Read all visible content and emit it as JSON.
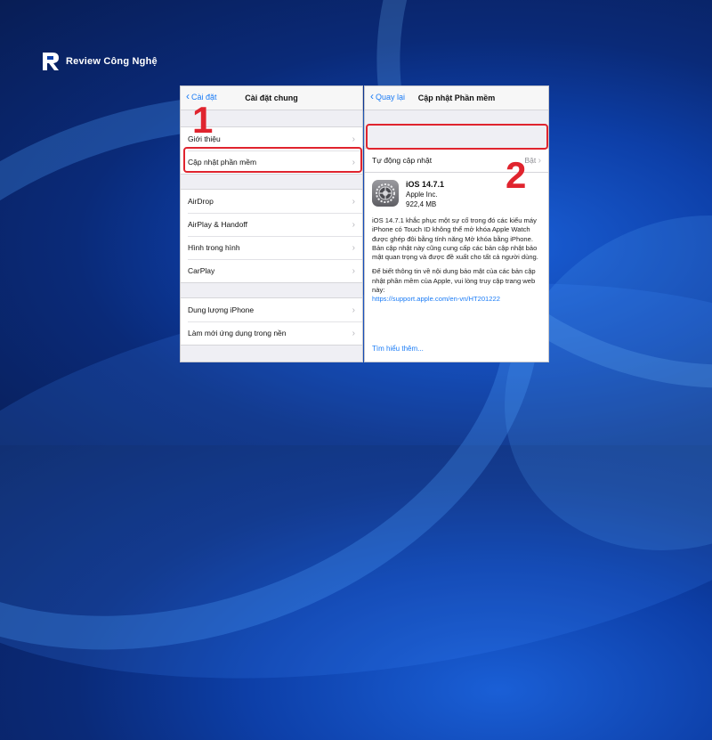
{
  "brand": {
    "name": "Review Công Nghệ"
  },
  "left_panel": {
    "back_label": "Cài đặt",
    "title": "Cài đặt chung",
    "groups": [
      [
        "Giới thiệu",
        "Cập nhật phần mềm"
      ],
      [
        "AirDrop",
        "AirPlay & Handoff",
        "Hình trong hình",
        "CarPlay"
      ],
      [
        "Dung lượng iPhone",
        "Làm mới ứng dụng trong nền"
      ]
    ]
  },
  "right_panel": {
    "back_label": "Quay lại",
    "title": "Cập nhật Phần mềm",
    "auto_update": {
      "label": "Tự động cập nhật",
      "value": "Bật"
    },
    "update": {
      "name": "iOS 14.7.1",
      "vendor": "Apple Inc.",
      "size": "922,4 MB",
      "description": "iOS 14.7.1 khắc phục một sự cố trong đó các kiểu máy iPhone có Touch ID không thể mở khóa Apple Watch được ghép đôi bằng tính năng Mở khóa bằng iPhone. Bản cập nhật này cũng cung cấp các bản cập nhật bảo mật quan trọng và được đề xuất cho tất cả người dùng.",
      "security_note": "Để biết thông tin về nội dung bảo mật của các bản cập nhật phần mềm của Apple, vui lòng truy cập trang web này:",
      "security_link": "https://support.apple.com/en-vn/HT201222",
      "learn_more": "Tìm hiểu thêm..."
    }
  },
  "annotations": {
    "step1": "1",
    "step2": "2"
  },
  "colors": {
    "ios_blue": "#1b7cf6",
    "highlight_red": "#e0242e"
  },
  "icons": [
    "brand-logo-icon",
    "chevron-left-icon",
    "chevron-right-icon",
    "settings-gear-icon"
  ]
}
